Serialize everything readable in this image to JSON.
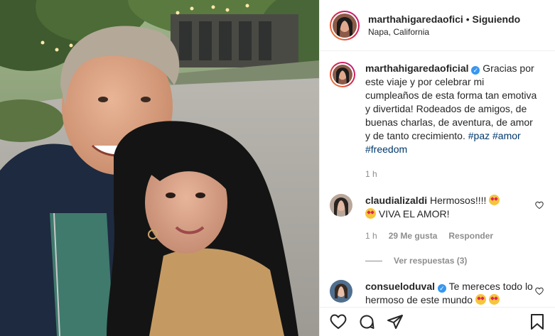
{
  "header": {
    "username": "marthahigaredaofici",
    "separator": "•",
    "follow_status": "Siguiendo",
    "location": "Napa, California"
  },
  "caption": {
    "username": "marthahigaredaoficial",
    "text": "Gracias por este viaje y por celebrar mi cumpleaños de esta forma tan emotiva y divertida! Rodeados de amigos, de buenas charlas, de aventura, de amor y de tanto crecimiento.",
    "tags": [
      "#paz",
      "#amor",
      "#freedom"
    ],
    "time": "1 h"
  },
  "comments": [
    {
      "username": "claudializaldi",
      "text1": "Hermosos!!!!",
      "text2": "VIVA EL AMOR!",
      "time": "1 h",
      "likes": "29 Me gusta",
      "reply_label": "Responder",
      "view_replies": "Ver respuestas (3)"
    },
    {
      "username": "consueloduval",
      "text": "Te mereces todo lo hermoso de este mundo"
    }
  ],
  "icons": {
    "like": "heart-icon",
    "comment": "comment-icon",
    "share": "send-icon",
    "save": "bookmark-icon",
    "verified": "verified-badge"
  },
  "colors": {
    "link": "#00376b",
    "verified": "#3897f0",
    "muted": "#8e8e8e"
  }
}
